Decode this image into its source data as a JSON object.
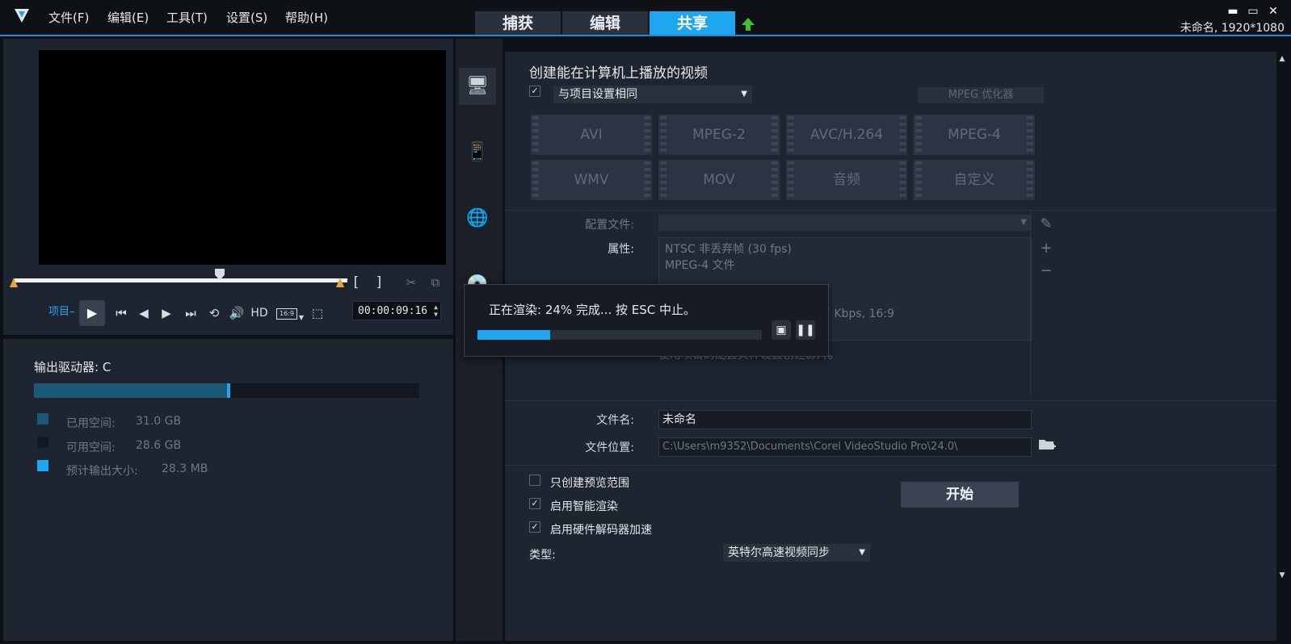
{
  "menu": {
    "file": "文件(F)",
    "edit": "编辑(E)",
    "tools": "工具(T)",
    "settings": "设置(S)",
    "help": "帮助(H)"
  },
  "tabs": {
    "capture": "捕获",
    "edit": "编辑",
    "share": "共享"
  },
  "window": {
    "minimize": "▬",
    "maximize": "▭",
    "close": "✕",
    "project_info": "未命名, 1920*1080"
  },
  "player": {
    "project_label": "项目–",
    "hd_label": "HD",
    "aspect_label": "16:9",
    "timecode": "00:00:09:16",
    "mark_in": "[",
    "mark_out": "]"
  },
  "storage": {
    "drive_label": "输出驱动器: C",
    "used_fraction": 0.5,
    "used_label": "已用空间:",
    "used_value": "31.0 GB",
    "free_label": "可用空间:",
    "free_value": "28.6 GB",
    "est_label": "预计输出大小:",
    "est_value": "28.3 MB",
    "colors": {
      "used": "#1b5876",
      "free": "#121722",
      "est": "#1ea7f0"
    }
  },
  "share": {
    "title": "创建能在计算机上播放的视频",
    "same_as_project": "与项目设置相同",
    "mpeg_optimizer": "MPEG 优化器",
    "formats": [
      "AVI",
      "MPEG-2",
      "AVC/H.264",
      "MPEG-4",
      "WMV",
      "MOV",
      "音频",
      "自定义"
    ],
    "profile_label": "配置文件:",
    "properties_label": "属性:",
    "properties": [
      "NTSC 非丢弃帧 (30 fps)",
      "MPEG-4 文件",
      "",
      "",
      "7 Kbps, 16:9"
    ],
    "properties_desc": "使用项目的配置文件设置创建影片。",
    "filename_label": "文件名:",
    "filename_value": "未命名",
    "location_label": "文件位置:",
    "location_value": "C:\\Users\\m9352\\Documents\\Corel VideoStudio Pro\\24.0\\",
    "opt_preview_range": "只创建预览范围",
    "opt_smart_render": "启用智能渲染",
    "opt_hw_decoder": "启用硬件解码器加速",
    "type_label": "类型:",
    "type_value": "英特尔高速视频同步",
    "start_button": "开始"
  },
  "render_dialog": {
    "message": "正在渲染: 24% 完成... 按 ESC 中止。",
    "progress_fraction": 0.24
  },
  "accent_color": "#1ea7f0"
}
